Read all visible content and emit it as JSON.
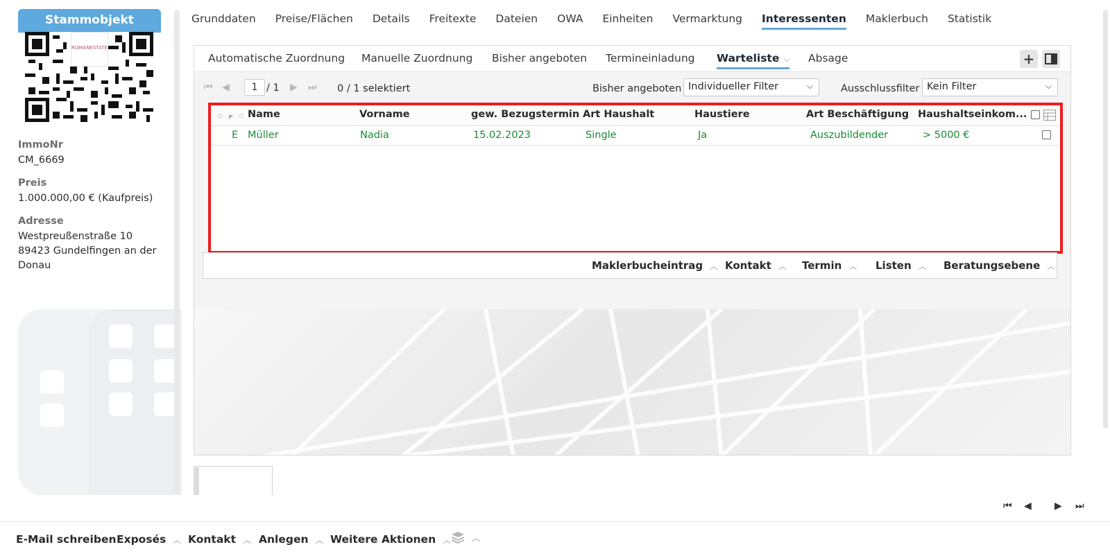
{
  "left": {
    "header": "Stammobjekt",
    "qr_logo_text": "ROMANESTATE",
    "immonr_label": "ImmoNr",
    "immonr_value": "CM_6669",
    "preis_label": "Preis",
    "preis_value": "1.000.000,00 € (Kaufpreis)",
    "adresse_label": "Adresse",
    "adresse_line1": "Westpreußenstraße 10",
    "adresse_line2": "89423 Gundelfingen an der",
    "adresse_line3": "Donau"
  },
  "main_tabs": [
    "Grunddaten",
    "Preise/Flächen",
    "Details",
    "Freitexte",
    "Dateien",
    "OWA",
    "Einheiten",
    "Vermarktung",
    "Interessenten",
    "Maklerbuch",
    "Statistik"
  ],
  "active_main_tab": "Interessenten",
  "sub_tabs": {
    "auto": "Automatische Zuordnung",
    "manual": "Manuelle Zuordnung",
    "offered": "Bisher angeboten",
    "invite": "Termineinladung",
    "waitlist": "Warteliste",
    "reject": "Absage"
  },
  "toolbar": {
    "page_current": "1",
    "page_total": "/ 1",
    "selected": "0 / 1 selektiert",
    "offered_label": "Bisher angeboten",
    "offered_value": "Individueller Filter",
    "exclusion_label": "Ausschlussfilter",
    "exclusion_value": "Kein Filter"
  },
  "table": {
    "columns": [
      "Name",
      "Vorname",
      "gew. Bezugstermin",
      "Art Haushalt",
      "Haustiere",
      "Art Beschäftigung",
      "Haushaltseinkom..."
    ],
    "rows": [
      {
        "flag": "E",
        "name": "Müller",
        "vorname": "Nadia",
        "bezug": "15.02.2023",
        "haushalt": "Single",
        "haustiere": "Ja",
        "beschaeftigung": "Auszubildender",
        "einkommen": "> 5000 €"
      }
    ]
  },
  "action_bar": [
    "Maklerbucheintrag",
    "Kontakt",
    "Termin",
    "Listen",
    "Beratungsebene"
  ],
  "footer": [
    "E-Mail schreiben",
    "Exposés",
    "Kontakt",
    "Anlegen",
    "Weitere Aktionen"
  ],
  "colors": {
    "accent": "#5ea9dd",
    "row_text": "#1c8a34",
    "highlight": "#ee1c1c"
  }
}
